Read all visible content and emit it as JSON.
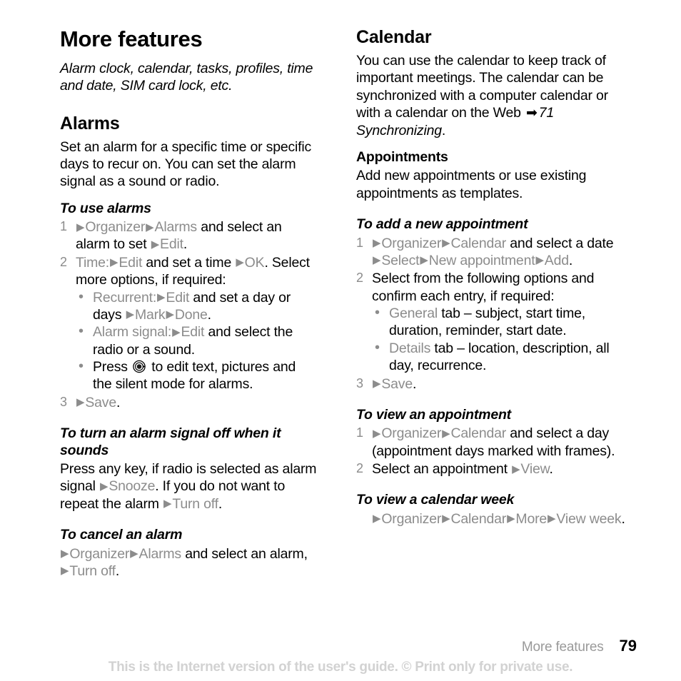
{
  "page": {
    "title": "More features",
    "subtitle": "Alarm clock, calendar, tasks, profiles, time and date, SIM card lock, etc.",
    "colors": {
      "menu_gray": "#8c8c8c",
      "text_black": "#000000",
      "watermark_gray": "#d2d2d2",
      "footer_gray": "#9a9a9a"
    }
  },
  "left_column": {
    "alarms": {
      "heading": "Alarms",
      "intro": "Set an alarm for a specific time or specific days to recur on. You can set the alarm signal as a sound or radio.",
      "proc_use_alarms": {
        "title": "To use alarms",
        "step1": {
          "num": "1",
          "arrow1": "▶",
          "menu1": "Organizer",
          "arrow2": "▶",
          "menu2": "Alarms",
          "text1": " and select an alarm to set ",
          "arrow3": "▶",
          "menu3": "Edit",
          "text2": "."
        },
        "step2": {
          "num": "2",
          "menu1": "Time:",
          "arrow1": "▶",
          "menu2": "Edit",
          "text1": " and set a time ",
          "arrow2": "▶",
          "menu3": "OK",
          "text2": ".",
          "text3": "Select more options, if required:",
          "bullets": [
            {
              "dot": "•",
              "menu1": "Recurrent:",
              "arrow1": "▶",
              "menu2": "Edit",
              "text1": " and set a day or days ",
              "arrow2": "▶",
              "menu3": "Mark",
              "arrow3": "▶",
              "menu4": "Done",
              "text2": "."
            },
            {
              "dot": "•",
              "menu1": "Alarm signal:",
              "arrow1": "▶",
              "menu2": "Edit",
              "text1": " and select the radio or a sound.",
              "text2": ""
            },
            {
              "dot": "•",
              "text_before_icon": "Press ",
              "icon": "joystick-icon",
              "text_after_icon": " to edit text, pictures and the silent mode for alarms."
            }
          ]
        },
        "step3": {
          "num": "3",
          "arrow1": "▶",
          "menu1": "Save",
          "text1": "."
        }
      },
      "proc_turn_off": {
        "title": "To turn an alarm signal off when it sounds",
        "text1": "Press any key, if radio is selected as alarm signal ",
        "arrow1": "▶",
        "menu1": "Snooze",
        "text2": ". If you do not want to repeat the alarm ",
        "arrow2": "▶",
        "menu2": "Turn off",
        "text3": "."
      },
      "proc_cancel": {
        "title": "To cancel an alarm",
        "arrow1": "▶",
        "menu1": "Organizer",
        "arrow2": "▶",
        "menu2": "Alarms",
        "text1": " and select an alarm, ",
        "arrow3": "▶",
        "menu3": "Turn off",
        "text2": "."
      }
    }
  },
  "right_column": {
    "calendar": {
      "heading": "Calendar",
      "intro_part1": "You can use the calendar to keep track of important meetings. The calendar can be synchronized with a computer calendar or with a calendar on the Web ",
      "xref_arrow": "➡",
      "xref": "71 Synchronizing",
      "intro_end": ".",
      "appointments": {
        "heading": "Appointments",
        "intro": "Add new appointments or use existing appointments as templates."
      },
      "proc_add": {
        "title": "To add a new appointment",
        "step1": {
          "num": "1",
          "arrow1": "▶",
          "menu1": "Organizer",
          "arrow2": "▶",
          "menu2": "Calendar",
          "text1": " and select a date ",
          "arrow3": "▶",
          "menu3": "Select",
          "arrow4": "▶",
          "menu4": "New appointment",
          "arrow5": "▶",
          "menu5": "Add",
          "text2": "."
        },
        "step2": {
          "num": "2",
          "text1": "Select from the following options and confirm each entry, if required:",
          "bullets": [
            {
              "dot": "•",
              "menu1": "General",
              "text1": " tab – subject, start time, duration, reminder, start date."
            },
            {
              "dot": "•",
              "menu1": "Details",
              "text1": " tab – location, description, all day, recurrence."
            }
          ]
        },
        "step3": {
          "num": "3",
          "arrow1": "▶",
          "menu1": "Save",
          "text1": "."
        }
      },
      "proc_view": {
        "title": "To view an appointment",
        "step1": {
          "num": "1",
          "arrow1": "▶",
          "menu1": "Organizer",
          "arrow2": "▶",
          "menu2": "Calendar",
          "text1": " and select a day (appointment days marked with frames)."
        },
        "step2": {
          "num": "2",
          "text1": "Select an appointment ",
          "arrow1": "▶",
          "menu1": "View",
          "text2": "."
        }
      },
      "proc_view_week": {
        "title": "To view a calendar week",
        "arrow1": "▶",
        "menu1": "Organizer",
        "arrow2": "▶",
        "menu2": "Calendar",
        "arrow3": "▶",
        "menu3": "More",
        "arrow4": "▶",
        "menu4": "View week",
        "text1": "."
      }
    }
  },
  "footer": {
    "chapter": "More features",
    "page_number": "79",
    "watermark": "This is the Internet version of the user's guide. © Print only for private use."
  }
}
